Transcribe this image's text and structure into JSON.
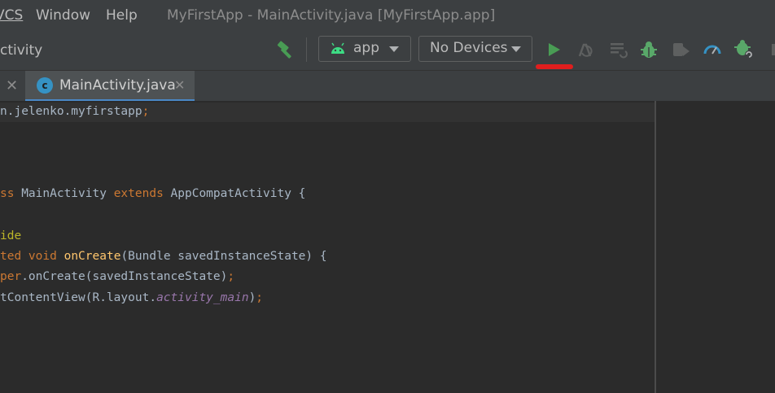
{
  "menu": {
    "vcs_partial": "VCS",
    "window": "Window",
    "help": "Help"
  },
  "window_title": "MyFirstApp - MainActivity.java [MyFirstApp.app]",
  "toolbar": {
    "breadcrumb_partial": "ctivity",
    "run_config": "app",
    "device_selector": "No Devices",
    "icons": [
      "hammer-build-icon",
      "android-icon",
      "run-icon",
      "apply-changes-icon",
      "apply-code-changes-icon",
      "debug-icon",
      "attach-debugger-icon",
      "profile-icon",
      "attach-debug-process-icon",
      "stop-icon"
    ]
  },
  "tabs": {
    "active_label": "MainActivity.java",
    "active_icon_letter": "c"
  },
  "editor": {
    "line1": {
      "text": "n.jelenko.myfirstapp",
      "semicolon": ";"
    },
    "line5": {
      "kw1": "ss",
      "name": " MainActivity ",
      "kw2": "extends",
      "rest": " AppCompatActivity {"
    },
    "line7": {
      "ann": "ide"
    },
    "line8": {
      "kw1": "ted",
      "kw2": " void ",
      "fn": "onCreate",
      "rest": "(Bundle savedInstanceState) {"
    },
    "line9": {
      "kw": "per",
      "rest": ".onCreate(savedInstanceState)",
      "semi": ";"
    },
    "line10": {
      "pre": "tContentView(R.layout.",
      "field": "activity_main",
      "post": ")",
      "semi": ";"
    }
  },
  "colors": {
    "run_green": "#499c54",
    "debug_green": "#59a869",
    "accent_red": "#e01e1e",
    "tab_underline": "#4a88c7"
  }
}
